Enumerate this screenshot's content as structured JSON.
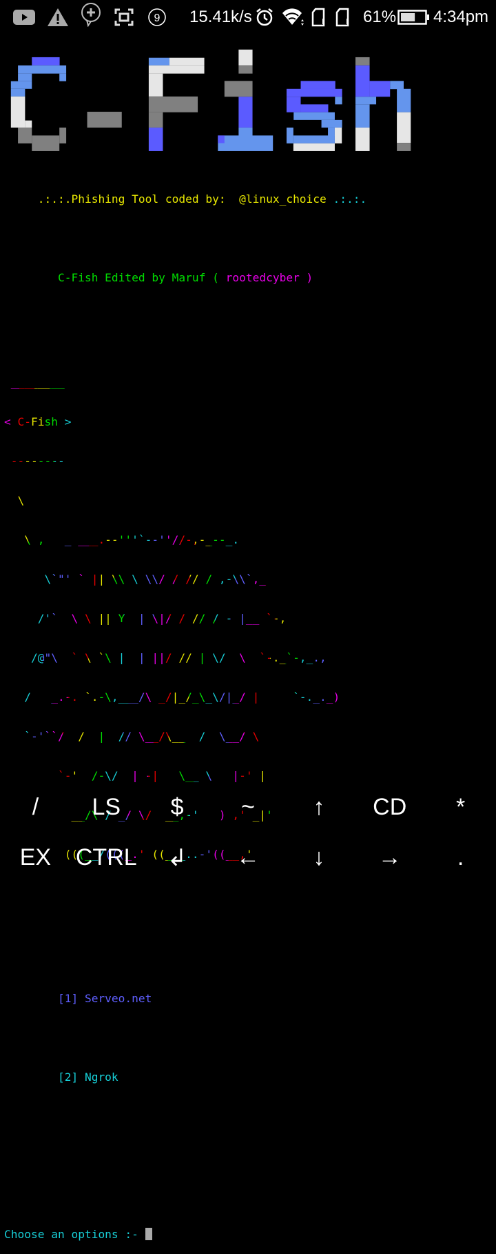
{
  "status_bar": {
    "icons": [
      "youtube-icon",
      "warning-icon",
      "chat-add-icon",
      "screenshot-icon",
      "notification-count-icon",
      "alarm-icon",
      "wifi-icon",
      "sim1-icon",
      "sim2-icon",
      "battery-icon"
    ],
    "notification_count": "9",
    "net_speed": "15.41k/s",
    "battery_percent": "61%",
    "battery_level": 0.61,
    "time": "4:34pm"
  },
  "logo": {
    "text": "C-Fish",
    "colors": [
      "#5b5bff",
      "#6495ed",
      "#e6e6e6",
      "#808080"
    ]
  },
  "terminal": {
    "credit_prefix": "     .:.:.Phishing Tool coded by:  @linux_choice",
    "credit_suffix": " .:.:.",
    "edited_prefix": "        C-Fish Edited by Maruf ( ",
    "edited_name": "rootedcyber",
    "edited_suffix": " )",
    "art_lines": [
      " ________",
      "< C-Fish >",
      " --------",
      "  \\",
      "   \\ ,   _ ___.--'''`--''//-,-_--_.",
      "      \\`\"' ` || \\\\ \\ \\\\/ / // / ,-\\\\`,_",
      "     /'`  \\ \\ || Y  | \\|/ / // / - |__ `-,",
      "    /@\"\\  ` \\ `\\ |  | ||/ // | \\/  \\  `-._`-,_.,",
      "   /   _.-. `.-\\,___/\\ _/|_/_\\_\\/|_/ |     `-._._)",
      "   `-'``/  /  |  // \\__/\\__  /  \\__/ \\",
      "        `-'  /-\\/  | -|   \\__ \\   |-' |",
      "          __/\\ / _/ \\/  __,-'   ) ,' _|'",
      "         (((__/(((_.' ((___..-'((__,'"
    ],
    "rainbow": [
      "#e800e8",
      "#e80000",
      "#e8e800",
      "#00dd00",
      "#17d0d8",
      "#5f5fff"
    ],
    "options": [
      {
        "label": "        [1] Serveo.net"
      },
      {
        "label": "        [2] Ngrok"
      }
    ],
    "prompt": "Choose an options :- "
  },
  "extra_keys": {
    "row1": [
      "/",
      "LS",
      "$",
      "~",
      "↑",
      "CD",
      "*"
    ],
    "row2": [
      "EX",
      "CTRL",
      "↲",
      "←",
      "↓",
      "→",
      "."
    ]
  }
}
